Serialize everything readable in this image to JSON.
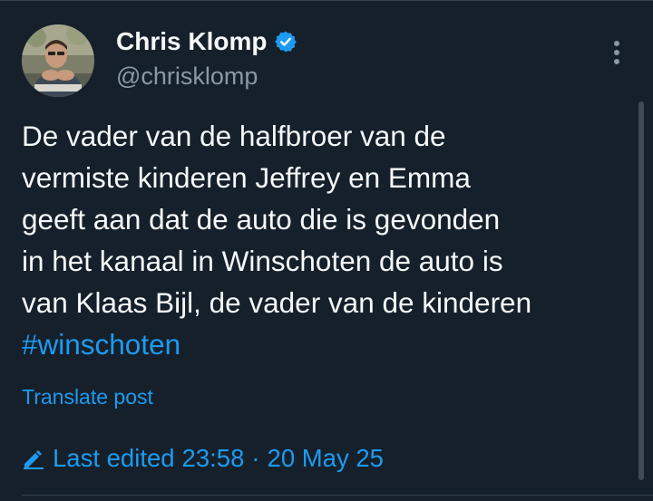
{
  "author": {
    "display_name": "Chris Klomp",
    "handle": "@chrisklomp",
    "verified": true
  },
  "tweet": {
    "lines": [
      "De vader van de halfbroer van de",
      "vermiste kinderen Jeffrey en Emma",
      "geeft aan dat de auto die is gevonden",
      "in het kanaal in Winschoten de auto is",
      "van Klaas Bijl, de vader van de kinderen"
    ],
    "hashtag": "#winschoten"
  },
  "actions": {
    "translate_label": "Translate post",
    "more_icon": "more-vertical-icon"
  },
  "edit_info": {
    "prefix": "Last edited",
    "time": "23:58",
    "separator": "·",
    "date": "20 May 25",
    "icon": "pencil-icon"
  },
  "colors": {
    "background": "#15202b",
    "text": "#f7f9f9",
    "secondary": "#8b98a5",
    "accent": "#1d9bf0",
    "divider": "#38444d"
  }
}
